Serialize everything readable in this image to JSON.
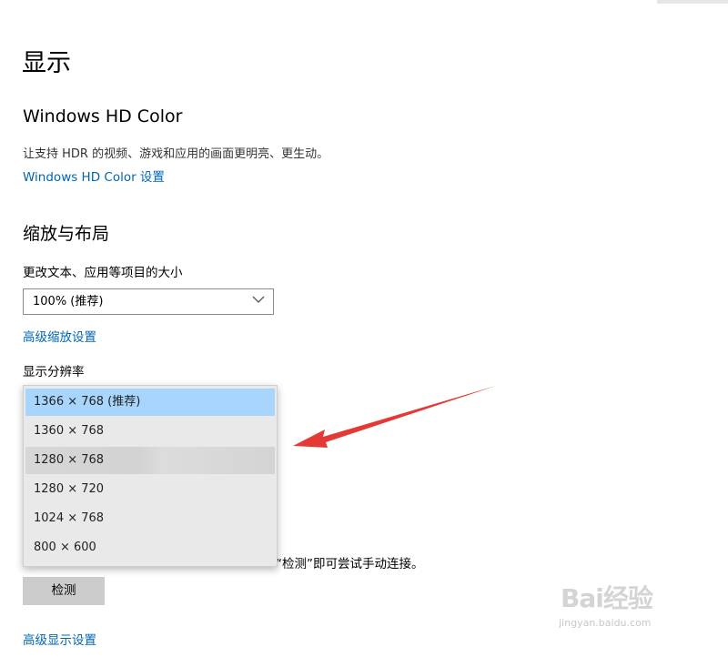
{
  "page": {
    "title": "显示"
  },
  "hd_color": {
    "title": "Windows HD Color",
    "description": "让支持 HDR 的视频、游戏和应用的画面更明亮、更生动。",
    "settings_link": "Windows HD Color 设置"
  },
  "scale_layout": {
    "title": "缩放与布局",
    "size_label": "更改文本、应用等项目的大小",
    "size_value": "100% (推荐)",
    "advanced_link": "高级缩放设置",
    "resolution_label": "显示分辨率"
  },
  "resolution_dropdown": {
    "options": [
      "1366 × 768 (推荐)",
      "1360 × 768",
      "1280 × 768",
      "1280 × 720",
      "1024 × 768",
      "800 × 600"
    ],
    "selected": "1366 × 768 (推荐)",
    "hovered": "1280 × 768"
  },
  "multi_display": {
    "partial_text": "“检测”即可尝试手动连接。",
    "detect_button": "检测",
    "advanced_display_link": "高级显示设置"
  },
  "watermark": {
    "brand": "Bai经验",
    "url": "jingyan.baidu.com"
  },
  "colors": {
    "link": "#0066b4",
    "selected": "#a8d5fb",
    "arrow": "#e53935"
  }
}
